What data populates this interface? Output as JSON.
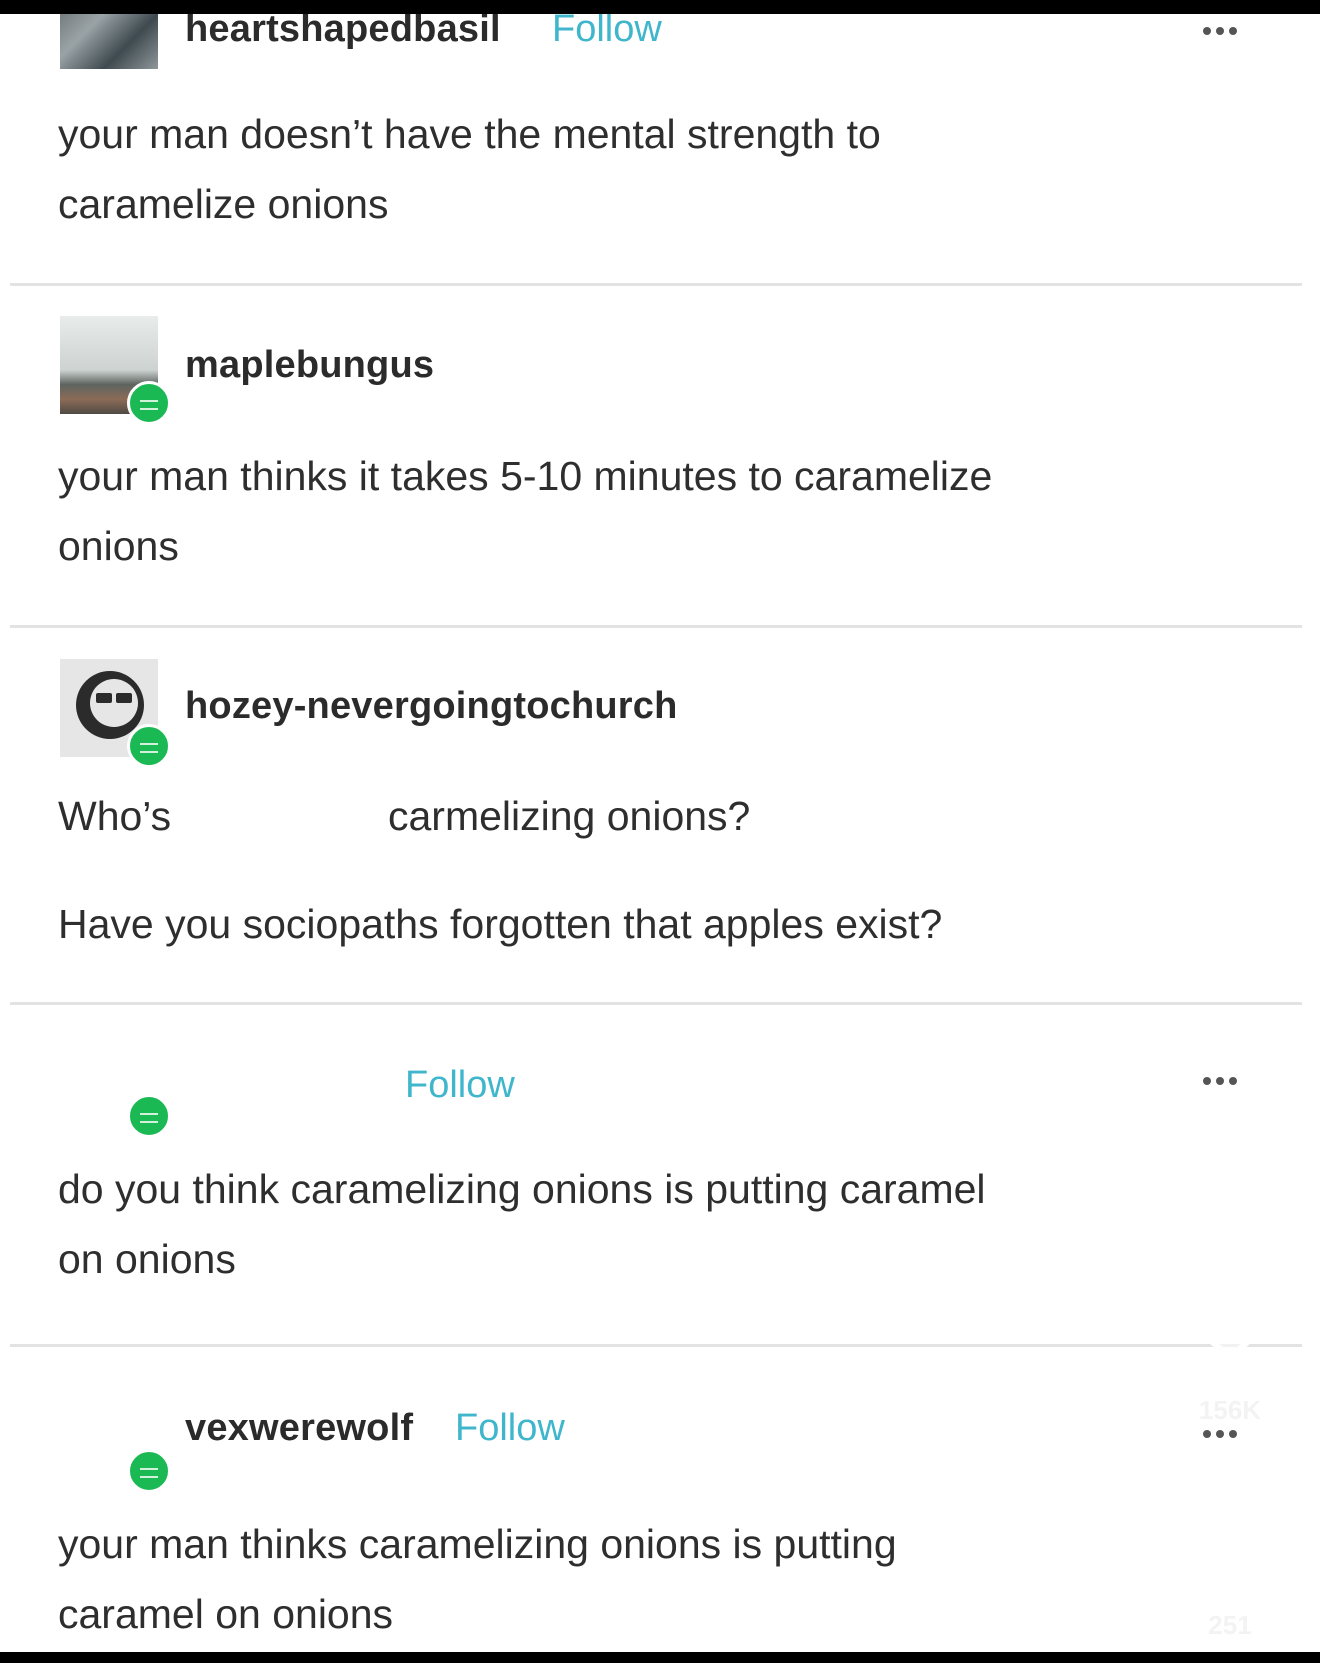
{
  "posts": [
    {
      "username": "heartshapedbasil",
      "follow_label": "Follow",
      "lines": [
        "your man doesn’t have the mental strength to",
        "caramelize onions"
      ]
    },
    {
      "username": "maplebungus",
      "lines": [
        "your man thinks it takes 5-10 minutes to caramelize",
        "onions"
      ]
    },
    {
      "username": "hozey-nevergoingtochurch",
      "lines": [
        "Who’s",
        "carmelizing onions?",
        "Have you sociopaths forgotten that apples exist?"
      ]
    },
    {
      "username": "",
      "follow_label": "Follow",
      "lines": [
        "do you think caramelizing onions is putting caramel",
        "on onions"
      ]
    },
    {
      "username": "vexwerewolf",
      "follow_label": "Follow",
      "lines": [
        "your man thinks caramelizing onions is putting",
        "caramel on onions"
      ]
    }
  ],
  "side_actions": {
    "like_count": "156K",
    "comment_count": "251",
    "like_icon": "heart-icon",
    "comment_icon": "comment-bubble-icon"
  },
  "colors": {
    "follow": "#3fb6cc",
    "badge": "#1bb954",
    "text": "#2e2e2e"
  }
}
